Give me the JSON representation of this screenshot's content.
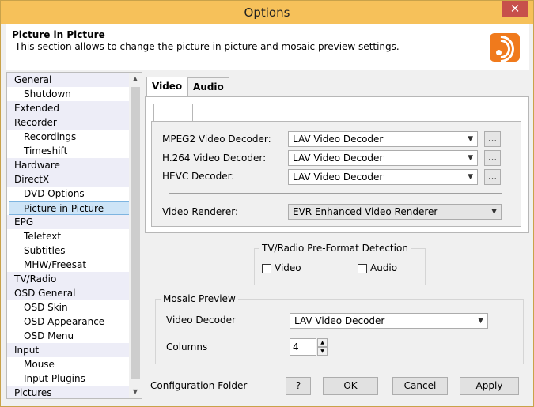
{
  "window": {
    "title": "Options",
    "close_glyph": "✕"
  },
  "header": {
    "title": "Picture in Picture",
    "description": "This section allows to change the picture in picture and mosaic preview settings.",
    "icon": "rss-icon",
    "icon_color": "#f07a1c"
  },
  "sidebar": {
    "items": [
      {
        "label": "General",
        "level": 0
      },
      {
        "label": "Shutdown",
        "level": 1
      },
      {
        "label": "Extended",
        "level": 0
      },
      {
        "label": "Recorder",
        "level": 0
      },
      {
        "label": "Recordings",
        "level": 1
      },
      {
        "label": "Timeshift",
        "level": 1
      },
      {
        "label": "Hardware",
        "level": 0
      },
      {
        "label": "DirectX",
        "level": 0
      },
      {
        "label": "DVD Options",
        "level": 1
      },
      {
        "label": "Picture in Picture",
        "level": 1,
        "selected": true
      },
      {
        "label": "EPG",
        "level": 0
      },
      {
        "label": "Teletext",
        "level": 1
      },
      {
        "label": "Subtitles",
        "level": 1
      },
      {
        "label": "MHW/Freesat",
        "level": 1
      },
      {
        "label": "TV/Radio",
        "level": 0
      },
      {
        "label": "OSD General",
        "level": 0
      },
      {
        "label": "OSD Skin",
        "level": 1
      },
      {
        "label": "OSD Appearance",
        "level": 1
      },
      {
        "label": "OSD Menu",
        "level": 1
      },
      {
        "label": "Input",
        "level": 0
      },
      {
        "label": "Mouse",
        "level": 1
      },
      {
        "label": "Input Plugins",
        "level": 1
      },
      {
        "label": "Pictures",
        "level": 0
      }
    ]
  },
  "tabs": [
    {
      "label": "Video",
      "active": true
    },
    {
      "label": "Audio",
      "active": false
    }
  ],
  "video": {
    "mpeg2_label": "MPEG2 Video Decoder:",
    "mpeg2_value": "LAV Video Decoder",
    "h264_label": "H.264 Video Decoder:",
    "h264_value": "LAV Video Decoder",
    "hevc_label": "HEVC Decoder:",
    "hevc_value": "LAV Video Decoder",
    "browse_label": "...",
    "renderer_label": "Video Renderer:",
    "renderer_value": "EVR Enhanced Video Renderer"
  },
  "preformat": {
    "title": "TV/Radio Pre-Format Detection",
    "video_label": "Video",
    "video_checked": false,
    "audio_label": "Audio",
    "audio_checked": false
  },
  "mosaic": {
    "title": "Mosaic Preview",
    "decoder_label": "Video Decoder",
    "decoder_value": "LAV Video Decoder",
    "columns_label": "Columns",
    "columns_value": "4"
  },
  "footer": {
    "config_link": "Configuration Folder",
    "help_label": "?",
    "ok_label": "OK",
    "cancel_label": "Cancel",
    "apply_label": "Apply"
  },
  "colors": {
    "titlebar": "#f6c15a",
    "close": "#c7504b",
    "selection": "#cde4f7"
  }
}
